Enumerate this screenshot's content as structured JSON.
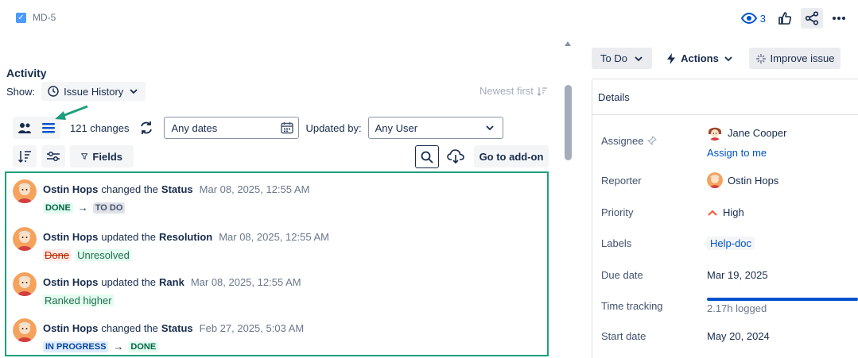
{
  "issue": {
    "key": "MD-5"
  },
  "top": {
    "watchers": "3"
  },
  "activity": {
    "title": "Activity",
    "show_label": "Show:",
    "show_value": "Issue History",
    "sort_label": "Newest first",
    "changes_count": "121 changes",
    "dates_value": "Any dates",
    "updated_by_label": "Updated by:",
    "user_value": "Any User",
    "fields_label": "Fields",
    "addon_label": "Go to add-on"
  },
  "history": [
    {
      "author": "Ostin Hops",
      "verb": "changed the",
      "field": "Status",
      "time": "Mar 08, 2025, 12:55 AM",
      "from": "DONE",
      "to": "TO DO"
    },
    {
      "author": "Ostin Hops",
      "verb": "updated the",
      "field": "Resolution",
      "time": "Mar 08, 2025, 12:55 AM",
      "old": "Done",
      "new": "Unresolved"
    },
    {
      "author": "Ostin Hops",
      "verb": "updated the",
      "field": "Rank",
      "time": "Mar 08, 2025, 12:55 AM",
      "new": "Ranked higher"
    },
    {
      "author": "Ostin Hops",
      "verb": "changed the",
      "field": "Status",
      "time": "Feb 27, 2025, 5:03 AM",
      "from": "IN PROGRESS",
      "to": "DONE"
    }
  ],
  "right": {
    "status_label": "To Do",
    "actions_label": "Actions",
    "improve_label": "Improve issue",
    "details_title": "Details",
    "fields": {
      "assignee_label": "Assignee",
      "assignee_value": "Jane Cooper",
      "assign_to_me": "Assign to me",
      "reporter_label": "Reporter",
      "reporter_value": "Ostin Hops",
      "priority_label": "Priority",
      "priority_value": "High",
      "labels_label": "Labels",
      "labels_value": "Help-doc",
      "due_label": "Due date",
      "due_value": "Mar 19, 2025",
      "time_label": "Time tracking",
      "time_value": "2.17h logged",
      "time_progress": 1.0,
      "start_label": "Start date",
      "start_value": "May 20, 2024"
    }
  },
  "colors": {
    "accent": "#0052cc",
    "highlight_border": "#1f9e7e",
    "priority_high": "#ff5630"
  }
}
